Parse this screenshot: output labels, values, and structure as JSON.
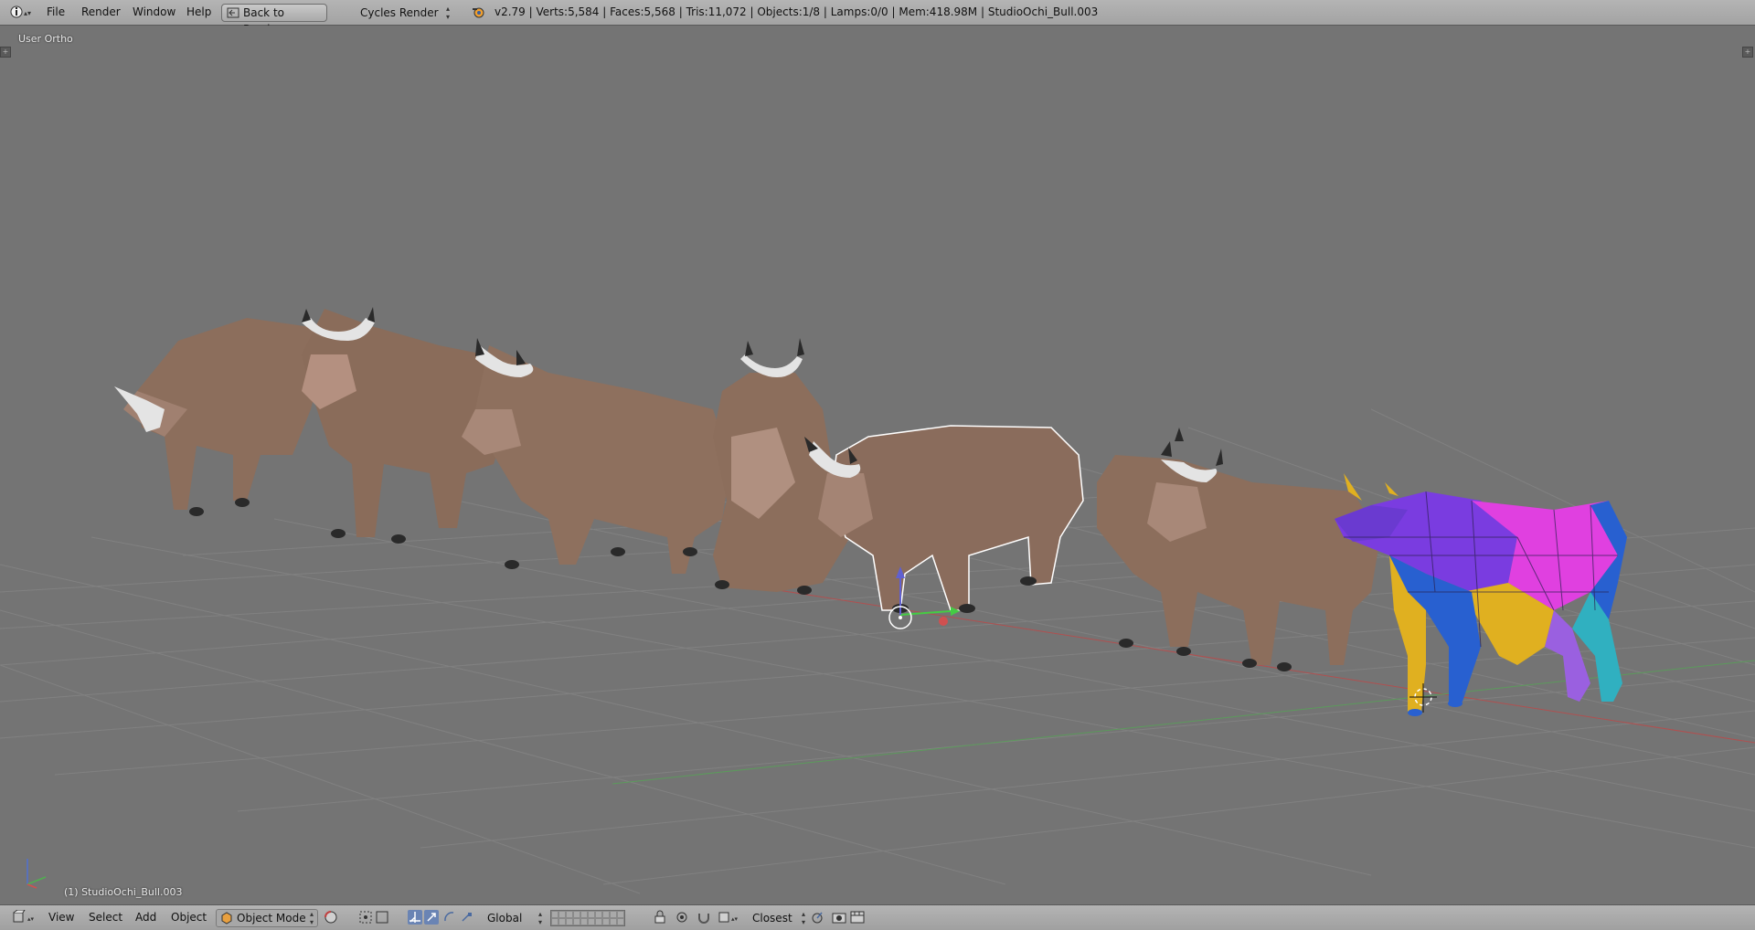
{
  "topbar": {
    "info_icon": "info-editor-icon",
    "menus": [
      "File",
      "Render",
      "Window",
      "Help"
    ],
    "back_button": "Back to Previous",
    "render_engine": "Cycles Render",
    "blender_icon": "blender-logo-icon",
    "stats": "v2.79 | Verts:5,584 | Faces:5,568 | Tris:11,072 | Objects:1/8 | Lamps:0/0 | Mem:418.98M | StudioOchi_Bull.003"
  },
  "viewport": {
    "view_label": "User Ortho",
    "object_label": "(1) StudioOchi_Bull.003",
    "colors": {
      "background": "#747474",
      "grid": "#828282",
      "x_axis": "#b05050",
      "y_axis": "#5c9a5c",
      "bull_brown": "#8c6e5c",
      "bull_light": "#b49080",
      "horn": "#e4e4e4",
      "hoof": "#2a2a2a",
      "selection_outline": "#ffffff",
      "uv_purple": "#7a3ce0",
      "uv_magenta": "#e040e0",
      "uv_blue": "#2860d0",
      "uv_yellow": "#e0b020",
      "uv_cyan": "#30b0c0"
    }
  },
  "bottombar": {
    "editor_icon": "3d-view-editor-icon",
    "menus": [
      "View",
      "Select",
      "Add",
      "Object"
    ],
    "mode": "Object Mode",
    "mode_icon": "object-mode-cube-icon",
    "shading_icon": "viewport-shading-sphere-icon",
    "pivot_icon": "pivot-point-icon",
    "manipulator_icons": [
      "manipulator-toggle-icon",
      "translate-icon",
      "rotate-icon",
      "scale-icon"
    ],
    "transform_orientation": "Global",
    "layers_count": 20,
    "lock_icon": "lock-camera-icon",
    "snap": "Closest",
    "snap_icons": [
      "proportional-edit-icon",
      "snap-magnet-icon",
      "snap-element-icon"
    ],
    "render_icons": [
      "opengl-render-icon",
      "opengl-animation-icon"
    ]
  }
}
